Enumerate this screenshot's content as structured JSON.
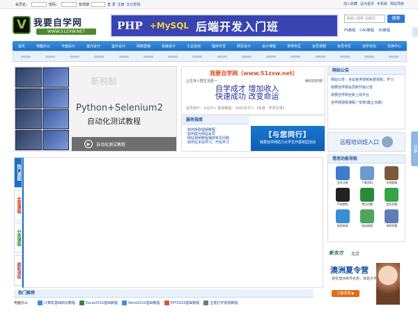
{
  "loginbar": {
    "user_label": "会员名：",
    "pass_label": "密码：",
    "login_btn": "登 录",
    "register": "注册",
    "forgot": "忘记密码",
    "select_label": "有效期",
    "remember": "自动登录"
  },
  "toplinks": [
    "加入收藏",
    "设为首页",
    "手机版",
    "网站导航"
  ],
  "logo": {
    "title": "我要自学网",
    "url": "WWW.51ZXW.NET"
  },
  "banner": {
    "php": "PHP",
    "mysql": "+MySQL",
    "text": "后端开发入门班"
  },
  "search": {
    "placeholder": "请输入视频 关键词",
    "button": "搜索"
  },
  "quicklinks": [
    "PS教程",
    "CAD教程",
    "3D教程"
  ],
  "nav": [
    "首页",
    "电脑办公",
    "平面设计",
    "室内设计",
    "室外设计",
    "网络营销",
    "机械设计",
    "工业自动",
    "程序开发",
    "网页设计",
    "会计课程",
    "讲师专区",
    "会员视频",
    "会员专区",
    "自学论坛",
    "兑换中心"
  ],
  "slider": {
    "new_label": "新税制",
    "title": "Python+Selenium2",
    "subtitle": "自动化测试教程",
    "bar_text": "自动化测试教程"
  },
  "center": {
    "title": "我要自学网（www.51zxw.net）",
    "intro_left": "让生存人群生活更一",
    "intro_right": "美好的时候",
    "slogan1": "自学成才  增加收入",
    "slogan2": "快速成功  改变命运",
    "meta": "会员用户：100万+ 视频教程：1000多万+  【免费 · 学员反馈】"
  },
  "service": {
    "heading": "服务指南",
    "items": [
      "如何获取视频教程",
      "如何成为网站会员",
      "网站视频教程播放常见问题",
      "如何在本站学习，开始学习"
    ],
    "promo_a": "【与您同行】",
    "promo_b": "我要自学网助力大学生开展校园活动"
  },
  "notice": {
    "heading": "网站公告",
    "items": [
      "网站公告：全站各类视频免费观看，学习",
      "我要自学网会员新升级公告",
      "我要自学网全新上线平台",
      "自学网视频课程一览表(截止日期)"
    ]
  },
  "training": {
    "label": "远程培训班入口"
  },
  "tools": {
    "heading": "常用功能导航",
    "items": [
      "会员注册",
      "下载资料",
      "在线客服",
      "手机教程",
      "常见问题",
      "会员充值",
      "使用帮助",
      "网站地图",
      "讲师招募"
    ]
  },
  "share": "分享",
  "tabs": [
    "热门课程",
    "全部课程",
    "分类课程",
    "最新课程"
  ],
  "hot": {
    "heading": "热门推荐",
    "category": "电脑办公",
    "items": [
      "计算机基础知识教程",
      "Excel2010基础教程",
      "Word2010基础教程",
      "PPT2010基础教程",
      "五笔打字视频教程"
    ]
  },
  "ad": {
    "brand": "新东方",
    "city": "北京",
    "title": "澳洲夏令营",
    "desc": "游览澳洲世界名校，体验大学全真课堂",
    "button": "了解详情 ▶"
  },
  "colors": {
    "nav": "#1f6fc5",
    "accent": "#e14a1e",
    "link": "#1a4f9c"
  }
}
